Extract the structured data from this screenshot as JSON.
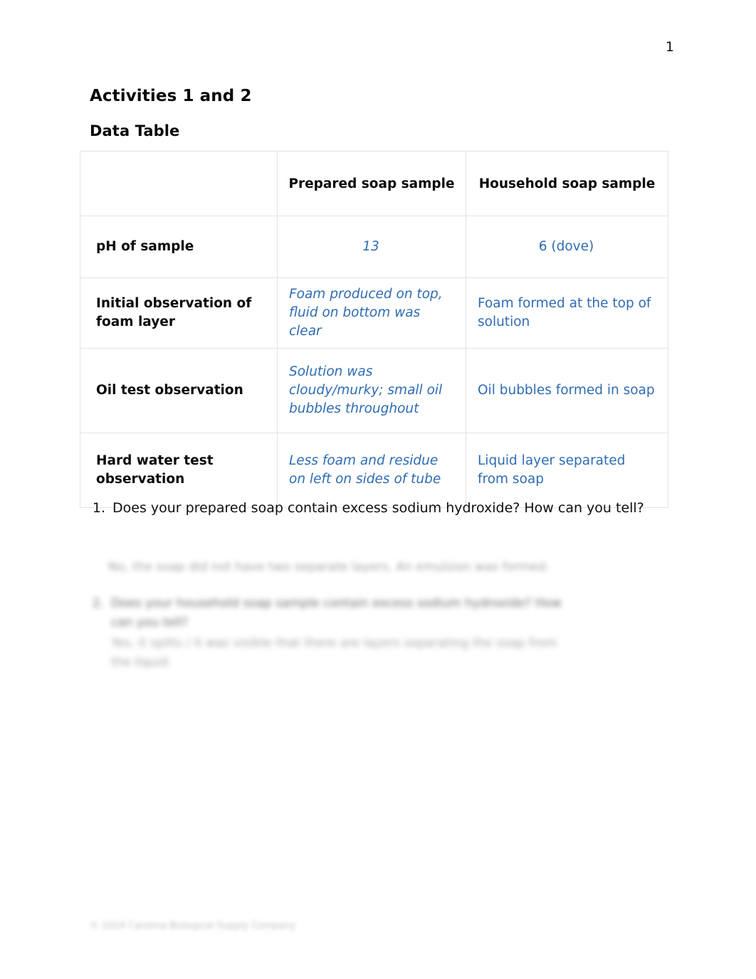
{
  "page": {
    "number": "1"
  },
  "headings": {
    "title": "Activities 1 and 2",
    "subtitle": "Data Table"
  },
  "table": {
    "columns": [
      {
        "key": "label",
        "header": ""
      },
      {
        "key": "prepared",
        "header": "Prepared soap sample"
      },
      {
        "key": "household",
        "header": "Household soap sample"
      }
    ],
    "rows": [
      {
        "label": "pH of sample",
        "prepared": "13",
        "household": "6 (dove)"
      },
      {
        "label": "Initial observation of foam layer",
        "prepared": "Foam produced on top, fluid on bottom was clear",
        "household": "Foam formed at the top of solution"
      },
      {
        "label": "Oil test observation",
        "prepared": "Solution was cloudy/murky; small oil bubbles throughout",
        "household": "Oil bubbles formed in soap"
      },
      {
        "label": "Hard water test observation",
        "prepared": "Less foam and residue on left on sides of tube",
        "household": "Liquid layer separated from soap"
      }
    ]
  },
  "questions": [
    {
      "number": "1.",
      "text": "Does your prepared soap contain excess sodium hydroxide? How can you tell?",
      "answer": "No, the soap did not have two separate layers. An emulsion was formed."
    },
    {
      "number": "2.",
      "text": "Does your household soap sample contain excess sodium hydroxide? How can you tell?",
      "answer": "Yes, it splits / it was visible that there are layers separating the soap from the liquid."
    }
  ],
  "footer": {
    "text": "© 2024 Carolina Biological Supply Company"
  }
}
